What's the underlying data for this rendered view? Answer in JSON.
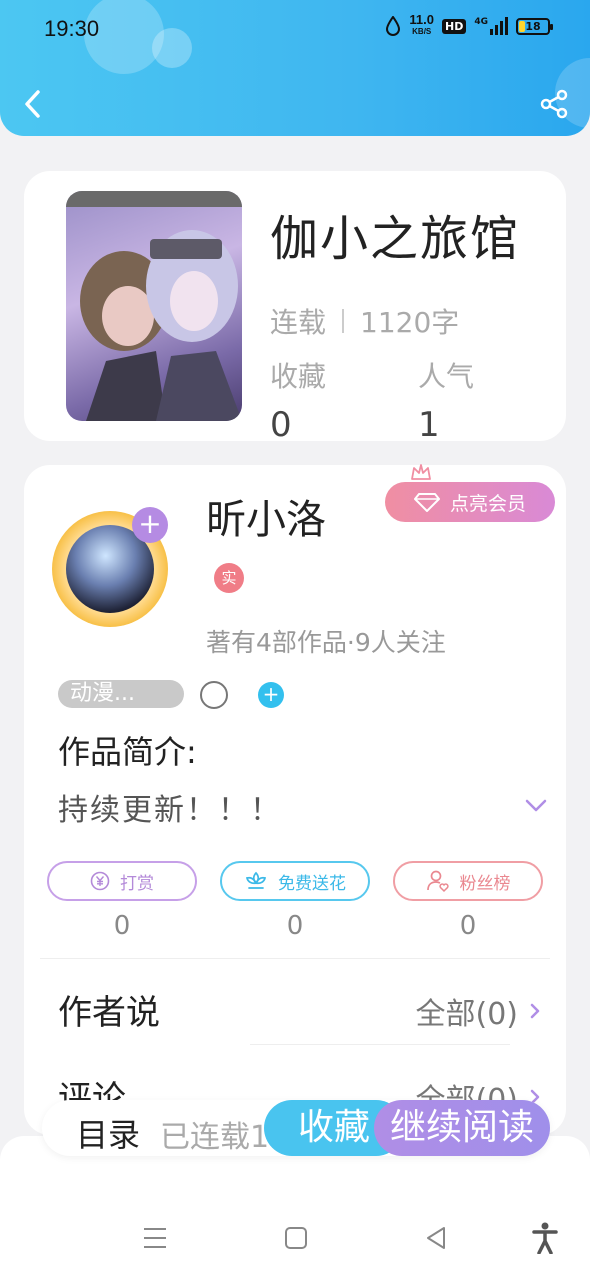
{
  "status_bar": {
    "time": "19:30",
    "net_speed": "11.0",
    "net_unit": "KB/S",
    "hd": "HD",
    "network": "4G",
    "battery": "18"
  },
  "book": {
    "title": "伽小之旅馆",
    "status": "连载",
    "word_count": "1120字",
    "fav_label": "收藏",
    "fav_value": "0",
    "pop_label": "人气",
    "pop_value": "1"
  },
  "author": {
    "name": "昕小洛",
    "vip_label": "点亮会员",
    "real_badge": "实",
    "meta": "著有4部作品·9人关注",
    "tag": "动漫...",
    "add_symbol": "+"
  },
  "intro": {
    "title": "作品简介:",
    "text": "持续更新！！！"
  },
  "actions": {
    "reward_label": "打赏",
    "reward_count": "0",
    "flower_label": "免费送花",
    "flower_count": "0",
    "fans_label": "粉丝榜",
    "fans_count": "0"
  },
  "sections": {
    "author_says": "作者说",
    "author_says_all": "全部(0)",
    "comments": "评论",
    "comments_all": "全部(0)"
  },
  "bottom_bar": {
    "toc": "目录",
    "serial": "已连载1",
    "fav": "收藏",
    "read": "继续阅读"
  },
  "colors": {
    "header": "#3fb6f0",
    "accent_purple": "#b08ee6",
    "accent_blue": "#49c4ef",
    "accent_pink": "#f08ea2"
  }
}
